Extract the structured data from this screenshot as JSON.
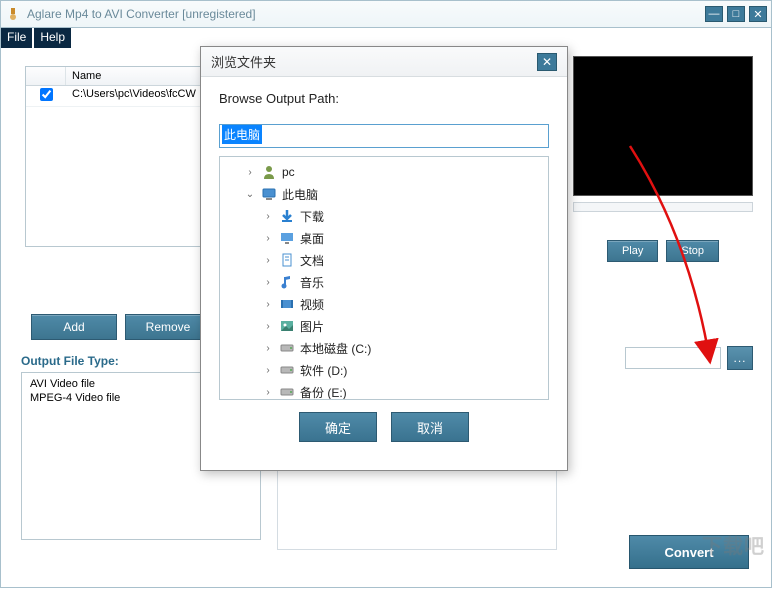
{
  "window": {
    "title": "Aglare Mp4 to AVI Converter  [unregistered]"
  },
  "menu": {
    "file": "File",
    "help": "Help"
  },
  "table": {
    "header_name": "Name",
    "rows": [
      {
        "checked": true,
        "name": "C:\\Users\\pc\\Videos\\fcCW"
      }
    ]
  },
  "buttons": {
    "add": "Add",
    "remove": "Remove",
    "play": "Play",
    "stop": "Stop",
    "convert": "Convert",
    "browse": "..."
  },
  "labels": {
    "output_file_type": "Output File Type:"
  },
  "file_types": [
    "AVI Video file",
    "MPEG-4 Video file"
  ],
  "dialog": {
    "title": "浏览文件夹",
    "label": "Browse Output Path:",
    "input_value": "此电脑",
    "ok": "确定",
    "cancel": "取消",
    "tree": [
      {
        "indent": 1,
        "twist": "›",
        "icon": "user",
        "label": "pc"
      },
      {
        "indent": 1,
        "twist": "⌄",
        "icon": "pc",
        "label": "此电脑"
      },
      {
        "indent": 2,
        "twist": "›",
        "icon": "download",
        "label": "下载"
      },
      {
        "indent": 2,
        "twist": "›",
        "icon": "desktop",
        "label": "桌面"
      },
      {
        "indent": 2,
        "twist": "›",
        "icon": "doc",
        "label": "文档"
      },
      {
        "indent": 2,
        "twist": "›",
        "icon": "music",
        "label": "音乐"
      },
      {
        "indent": 2,
        "twist": "›",
        "icon": "video",
        "label": "视频"
      },
      {
        "indent": 2,
        "twist": "›",
        "icon": "pic",
        "label": "图片"
      },
      {
        "indent": 2,
        "twist": "›",
        "icon": "drive",
        "label": "本地磁盘 (C:)"
      },
      {
        "indent": 2,
        "twist": "›",
        "icon": "drive",
        "label": "软件 (D:)"
      },
      {
        "indent": 2,
        "twist": "›",
        "icon": "drive",
        "label": "备份 (E:)"
      }
    ]
  },
  "watermark": "下载吧"
}
